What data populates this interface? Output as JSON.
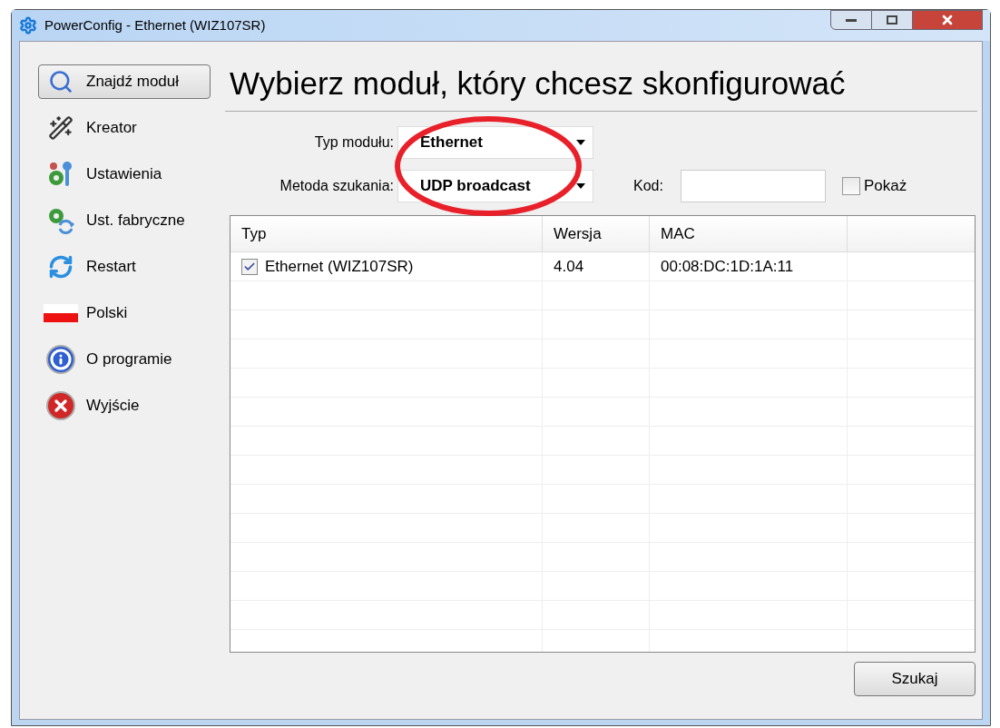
{
  "window": {
    "title": "PowerConfig - Ethernet (WIZ107SR)"
  },
  "sidebar": {
    "items": [
      {
        "label": "Znajdź moduł",
        "kind": "search",
        "selected": true
      },
      {
        "label": "Kreator",
        "kind": "wand",
        "selected": false
      },
      {
        "label": "Ustawienia",
        "kind": "gears",
        "selected": false
      },
      {
        "label": "Ust. fabryczne",
        "kind": "reset",
        "selected": false
      },
      {
        "label": "Restart",
        "kind": "restart",
        "selected": false
      },
      {
        "label": "Polski",
        "kind": "flag",
        "selected": false
      },
      {
        "label": "O programie",
        "kind": "info",
        "selected": false
      },
      {
        "label": "Wyjście",
        "kind": "exit",
        "selected": false
      }
    ]
  },
  "heading": "Wybierz moduł, który chcesz skonfigurować",
  "form": {
    "module_type": {
      "label": "Typ modułu:",
      "value": "Ethernet"
    },
    "search_method": {
      "label": "Metoda szukania:",
      "value": "UDP broadcast"
    },
    "code": {
      "label": "Kod:"
    },
    "show": {
      "label": "Pokaż",
      "checked": false
    }
  },
  "table": {
    "columns": [
      "Typ",
      "Wersja",
      "MAC"
    ],
    "rows": [
      {
        "checked": true,
        "cells": [
          "Ethernet (WIZ107SR)",
          "4.04",
          "00:08:DC:1D:1A:11"
        ]
      }
    ]
  },
  "buttons": {
    "search": "Szukaj"
  }
}
